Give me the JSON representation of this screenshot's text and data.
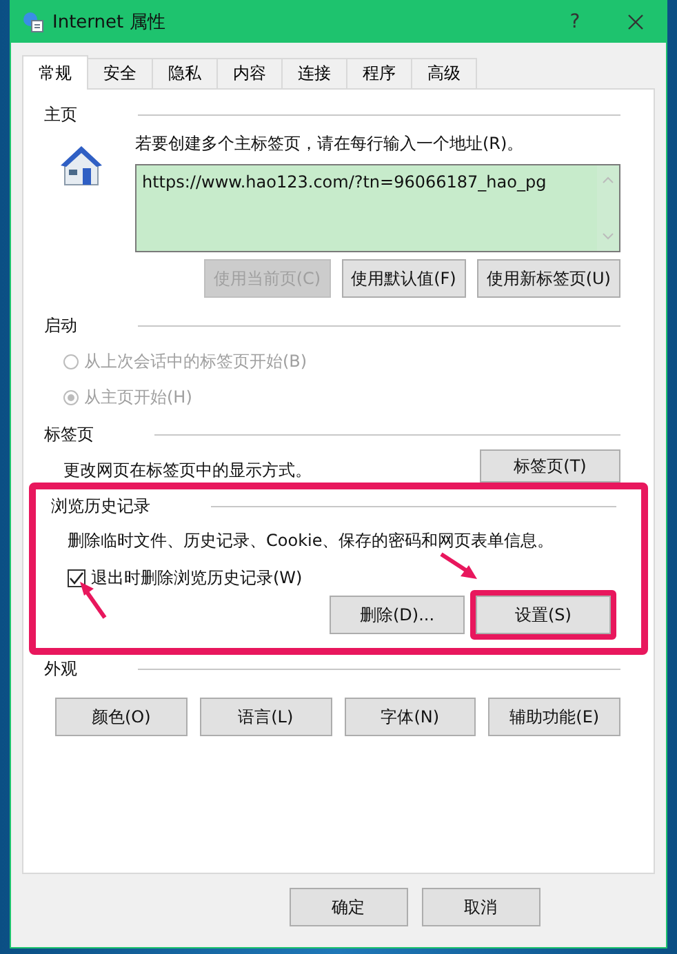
{
  "window": {
    "title": "Internet 属性",
    "help": "?"
  },
  "tabs": [
    {
      "label": "常规",
      "selected": true
    },
    {
      "label": "安全",
      "selected": false
    },
    {
      "label": "隐私",
      "selected": false
    },
    {
      "label": "内容",
      "selected": false
    },
    {
      "label": "连接",
      "selected": false
    },
    {
      "label": "程序",
      "selected": false
    },
    {
      "label": "高级",
      "selected": false
    }
  ],
  "homepage": {
    "heading": "主页",
    "instruction": "若要创建多个主标签页，请在每行输入一个地址(R)。",
    "urls": "https://www.hao123.com/?tn=96066187_hao_pg",
    "buttons": [
      {
        "label": "使用当前页(C)",
        "disabled": true
      },
      {
        "label": "使用默认值(F)",
        "disabled": false
      },
      {
        "label": "使用新标签页(U)",
        "disabled": false
      }
    ]
  },
  "startup": {
    "heading": "启动",
    "options": [
      {
        "label": "从上次会话中的标签页开始(B)",
        "selected": false,
        "disabled": true
      },
      {
        "label": "从主页开始(H)",
        "selected": true,
        "disabled": true
      }
    ]
  },
  "tabs_section": {
    "heading": "标签页",
    "description": "更改网页在标签页中的显示方式。",
    "button": "标签页(T)"
  },
  "history": {
    "heading": "浏览历史记录",
    "highlighted": true,
    "description": "删除临时文件、历史记录、Cookie、保存的密码和网页表单信息。",
    "checkbox": {
      "label": "退出时删除浏览历史记录(W)",
      "checked": true
    },
    "buttons": [
      {
        "label": "删除(D)...",
        "highlighted": false
      },
      {
        "label": "设置(S)",
        "highlighted": true
      }
    ]
  },
  "appearance": {
    "heading": "外观",
    "buttons": [
      "颜色(O)",
      "语言(L)",
      "字体(N)",
      "辅助功能(E)"
    ]
  },
  "footer": {
    "buttons": [
      "确定",
      "取消"
    ]
  }
}
